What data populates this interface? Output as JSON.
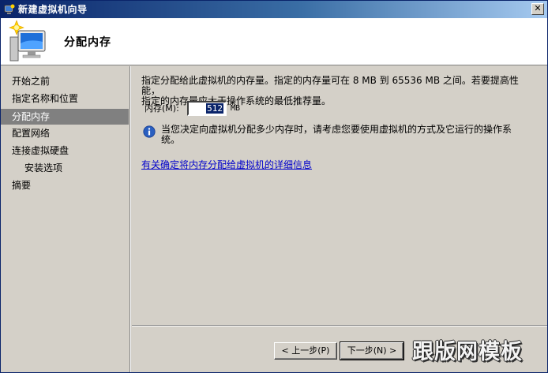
{
  "window": {
    "title": "新建虚拟机向导",
    "close_label": "✕"
  },
  "header": {
    "title": "分配内存"
  },
  "sidebar": {
    "items": [
      {
        "label": "开始之前"
      },
      {
        "label": "指定名称和位置"
      },
      {
        "label": "分配内存",
        "active": true
      },
      {
        "label": "配置网络"
      },
      {
        "label": "连接虚拟硬盘"
      },
      {
        "label": "安装选项",
        "sub": true
      },
      {
        "label": "摘要"
      }
    ]
  },
  "content": {
    "description_line1": "指定分配给此虚拟机的内存量。指定的内存量可在 8 MB 到 65536 MB 之间。若要提高性能，",
    "description_line2": "指定的内存量应大于操作系统的最低推荐量。",
    "memory_label": "内存(M):",
    "memory_value": "512",
    "memory_unit": "MB",
    "info_line1": "当您决定向虚拟机分配多少内存时，请考虑您要使用虚拟机的方式及它运行的操作系",
    "info_line2": "统。",
    "link_text": "有关确定将内存分配给虚拟机的详细信息"
  },
  "buttons": {
    "prev": "< 上一步(P)",
    "next": "下一步(N) >"
  },
  "watermark": "跟版网模板",
  "colors": {
    "titlebar": "#0a246a",
    "active_nav": "#808080",
    "link": "#0000cc",
    "face": "#d4d0c8"
  }
}
